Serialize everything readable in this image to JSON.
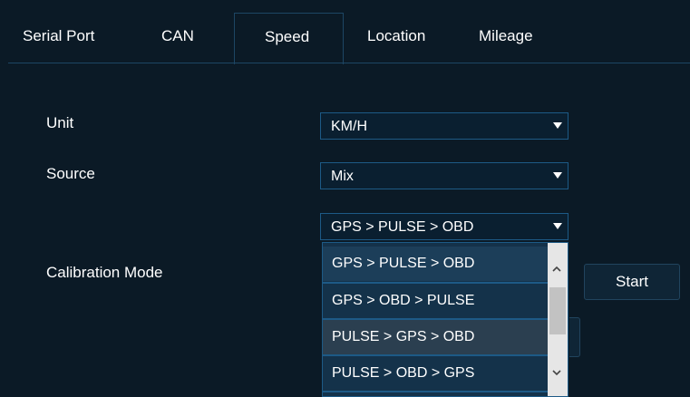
{
  "tabs": [
    {
      "label": "Serial Port"
    },
    {
      "label": "CAN"
    },
    {
      "label": "Speed"
    },
    {
      "label": "Location"
    },
    {
      "label": "Mileage"
    }
  ],
  "active_tab": "Speed",
  "form": {
    "unit": {
      "label": "Unit",
      "value": "KM/H"
    },
    "source": {
      "label": "Source",
      "value": "Mix"
    },
    "calibration": {
      "label": "Calibration Mode",
      "value": "GPS > PULSE > OBD"
    },
    "start_label": "Start"
  },
  "dropdown": {
    "options": [
      "GPS > PULSE > OBD",
      "GPS > OBD > PULSE",
      "PULSE > GPS > OBD",
      "PULSE > OBD > GPS"
    ],
    "selected_index": 0,
    "hover_index": 2
  },
  "colors": {
    "background": "#0b1a26",
    "border": "#1d5a86",
    "option_selected": "#1c3e59"
  },
  "icons": [
    "dropdown-arrow-icon",
    "scroll-up-icon",
    "scroll-down-icon"
  ]
}
